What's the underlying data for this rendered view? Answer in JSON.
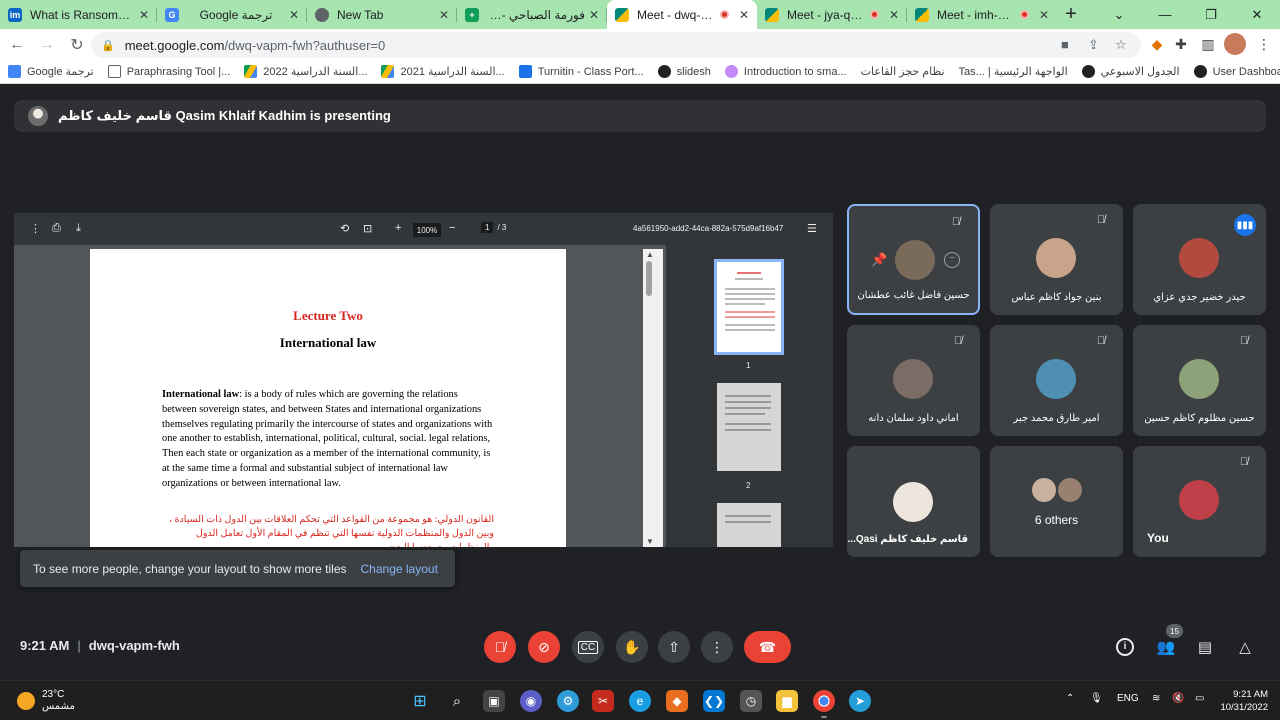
{
  "browser": {
    "tabs": [
      {
        "title": "What is Ransomware",
        "icon_color": "#0a66c2",
        "icon_letter": "im",
        "recording": false,
        "active": false
      },
      {
        "title": "Google ترجمة",
        "icon_color": "#4285f4",
        "icon_letter": "G",
        "recording": false,
        "active": false
      },
      {
        "title": "New Tab",
        "icon_color": "#5f6368",
        "icon_letter": "",
        "recording": false,
        "active": false
      },
      {
        "title": "فورمة الصباحي - اون لا",
        "icon_color": "#0f9d58",
        "icon_letter": "+",
        "recording": false,
        "active": false
      },
      {
        "title": "Meet - dwq-vapm",
        "icon_color": "#00897b",
        "icon_letter": "",
        "recording": true,
        "active": true
      },
      {
        "title": "Meet - jya-qypr-e",
        "icon_color": "#00897b",
        "icon_letter": "",
        "recording": true,
        "active": false
      },
      {
        "title": "Meet - imh-wgze",
        "icon_color": "#00897b",
        "icon_letter": "",
        "recording": true,
        "active": false
      }
    ],
    "url_host": "meet.google.com",
    "url_path": "/dwq-vapm-fwh?authuser=0",
    "bookmarks": [
      {
        "label": "Google ترجمة",
        "color": "#4285f4"
      },
      {
        "label": "Paraphrasing Tool |...",
        "color": "#5f6368"
      },
      {
        "label": "السنة الدراسية 2022...",
        "color": "#fbbc04"
      },
      {
        "label": "السنة الدراسية 2021...",
        "color": "#0f9d58"
      },
      {
        "label": "Turnitin - Class Port...",
        "color": "#1a73e8"
      },
      {
        "label": "slidesh",
        "color": "#202124"
      },
      {
        "label": "Introduction to sma...",
        "color": "#9c27b0"
      },
      {
        "label": "نظام حجز القاعات",
        "color": "#fff"
      },
      {
        "label": "Tas... | الواجهة الرئيسية",
        "color": "#fff"
      },
      {
        "label": "الجدول الاسبوعي",
        "color": "#202124"
      },
      {
        "label": "User Dashboard",
        "color": "#202124"
      }
    ]
  },
  "meet": {
    "banner": "قاسم خليف كاظم Qasim Khlaif Kadhim is presenting",
    "pdf": {
      "zoom": "100%",
      "page_current": "1",
      "page_total": "/ 3",
      "filename": "4a561950-add2-44ca-882a-575d9af16b47",
      "lecture_title": "Lecture Two",
      "subtitle": "International law",
      "term": "International law",
      "paragraph": ": is a body of rules which are governing the relations between sovereign states, and between States and international organizations themselves regulating primarily the intercourse of states and organizations with one another to establish, international, political, cultural, social. legal relations, Then each state or organization as a member of the international community, is at the same time a formal and substantial subject of international law organizations or between international law.",
      "arabic": "القانون الدولي: هو مجموعة من القواعد التي تحكم العلاقات بين الدول ذات السيادة ، وبين الدول والمنظمات الدولية نفسها التي تنظم في المقام الأول تعامل الدول والمنظمات مع بعضها البعض",
      "thumb_labels": [
        "1",
        "2"
      ]
    },
    "tiles": [
      {
        "name": "حسين فاضل غائب عطشان",
        "muted": true,
        "selected": true,
        "speaking": false,
        "avatar": "#7a6a5a"
      },
      {
        "name": "بنين جواد كاظم عباس",
        "muted": true,
        "selected": false,
        "speaking": false,
        "avatar": "#c9a48a"
      },
      {
        "name": "حيدر خضير جدي عزاي",
        "muted": false,
        "selected": false,
        "speaking": true,
        "avatar": "#b24a3f"
      },
      {
        "name": "اماني داود سلمان دانه",
        "muted": true,
        "selected": false,
        "speaking": false,
        "avatar": "#7c6c66"
      },
      {
        "name": "امير طارق محمد جبر",
        "muted": true,
        "selected": false,
        "speaking": false,
        "avatar": "#4f8fb3"
      },
      {
        "name": "حسين مظلوم كاظم حسين",
        "muted": true,
        "selected": false,
        "speaking": false,
        "avatar": "#8ea27a"
      },
      {
        "name": "قاسم خليف كاظم Qasi...",
        "muted": false,
        "selected": false,
        "speaking": false,
        "avatar": "#ede6dc"
      },
      {
        "name": "6 others",
        "muted": false,
        "selected": false,
        "speaking": false,
        "avatar": "#9a8070"
      },
      {
        "name": "You",
        "muted": true,
        "selected": false,
        "speaking": false,
        "avatar": "#c0404a"
      }
    ],
    "toast_text": "To see more people, change your layout to show more tiles",
    "toast_action": "Change layout",
    "time": "9:21 AM",
    "meeting_code": "dwq-vapm-fwh",
    "participant_count": "15"
  },
  "taskbar": {
    "temperature": "23°C",
    "weather": "مشمس",
    "language": "ENG",
    "time": "9:21 AM",
    "date": "10/31/2022"
  }
}
